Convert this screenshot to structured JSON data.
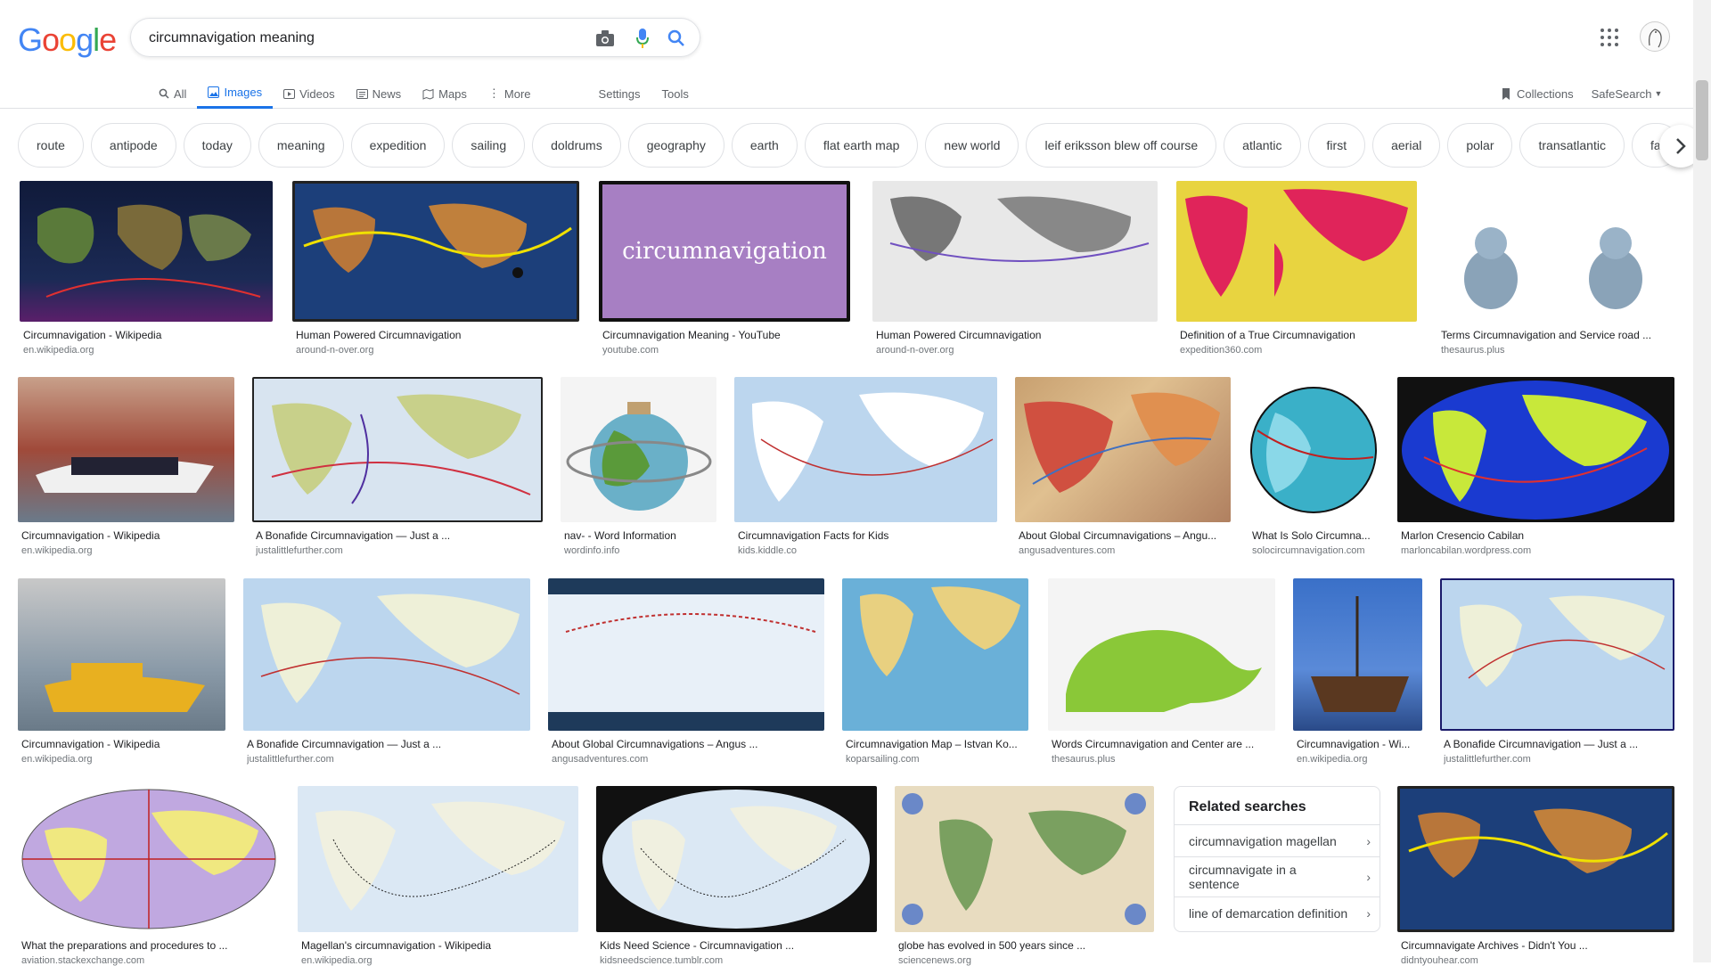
{
  "logo": "Google",
  "search": {
    "value": "circumnavigation meaning"
  },
  "tabs": [
    {
      "label": "All",
      "icon": "search-icon"
    },
    {
      "label": "Images",
      "icon": "image-icon",
      "active": true
    },
    {
      "label": "Videos",
      "icon": "video-icon"
    },
    {
      "label": "News",
      "icon": "news-icon"
    },
    {
      "label": "Maps",
      "icon": "map-icon"
    },
    {
      "label": "More",
      "icon": "more-icon"
    }
  ],
  "tools": {
    "settings": "Settings",
    "tools": "Tools"
  },
  "right_links": {
    "collections": "Collections",
    "safesearch": "SafeSearch"
  },
  "chips": [
    "route",
    "antipode",
    "today",
    "meaning",
    "expedition",
    "sailing",
    "doldrums",
    "geography",
    "earth",
    "flat earth map",
    "new world",
    "leif eriksson blew off course",
    "atlantic",
    "first",
    "aerial",
    "polar",
    "transatlantic",
    "fa"
  ],
  "results": [
    {
      "title": "Circumnavigation - Wikipedia",
      "source": "en.wikipedia.org"
    },
    {
      "title": "Human Powered Circumnavigation",
      "source": "around-n-over.org"
    },
    {
      "title": "Circumnavigation Meaning - YouTube",
      "source": "youtube.com",
      "overlay": "circumnavigation"
    },
    {
      "title": "Human Powered Circumnavigation",
      "source": "around-n-over.org"
    },
    {
      "title": "Definition of a True Circumnavigation",
      "source": "expedition360.com"
    },
    {
      "title": "Terms Circumnavigation and Service road ...",
      "source": "thesaurus.plus"
    },
    {
      "title": "Circumnavigation - Wikipedia",
      "source": "en.wikipedia.org"
    },
    {
      "title": "A Bonafide Circumnavigation — Just a ...",
      "source": "justalittlefurther.com"
    },
    {
      "title": "nav- - Word Information",
      "source": "wordinfo.info"
    },
    {
      "title": "Circumnavigation Facts for Kids",
      "source": "kids.kiddle.co"
    },
    {
      "title": "About Global Circumnavigations – Angu...",
      "source": "angusadventures.com"
    },
    {
      "title": "What Is Solo Circumna...",
      "source": "solocircumnavigation.com"
    },
    {
      "title": "Marlon Cresencio Cabilan",
      "source": "marloncabilan.wordpress.com"
    },
    {
      "title": "Circumnavigation - Wikipedia",
      "source": "en.wikipedia.org"
    },
    {
      "title": "A Bonafide Circumnavigation — Just a ...",
      "source": "justalittlefurther.com"
    },
    {
      "title": "About Global Circumnavigations – Angus ...",
      "source": "angusadventures.com"
    },
    {
      "title": "Circumnavigation Map – Istvan Ko...",
      "source": "koparsailing.com"
    },
    {
      "title": "Words Circumnavigation and Center are ...",
      "source": "thesaurus.plus"
    },
    {
      "title": "Circumnavigation - Wi...",
      "source": "en.wikipedia.org"
    },
    {
      "title": "A Bonafide Circumnavigation — Just a ...",
      "source": "justalittlefurther.com"
    },
    {
      "title": "What the preparations and procedures to ...",
      "source": "aviation.stackexchange.com"
    },
    {
      "title": "Magellan's circumnavigation - Wikipedia",
      "source": "en.wikipedia.org"
    },
    {
      "title": "Kids Need Science - Circumnavigation ...",
      "source": "kidsneedscience.tumblr.com"
    },
    {
      "title": "globe has evolved in 500 years since ...",
      "source": "sciencenews.org"
    },
    {
      "title": "Circumnavigate Archives - Didn't You ...",
      "source": "didntyouhear.com"
    }
  ],
  "related": {
    "heading": "Related searches",
    "items": [
      "circumnavigation magellan",
      "circumnavigate in a sentence",
      "line of demarcation definition"
    ]
  }
}
